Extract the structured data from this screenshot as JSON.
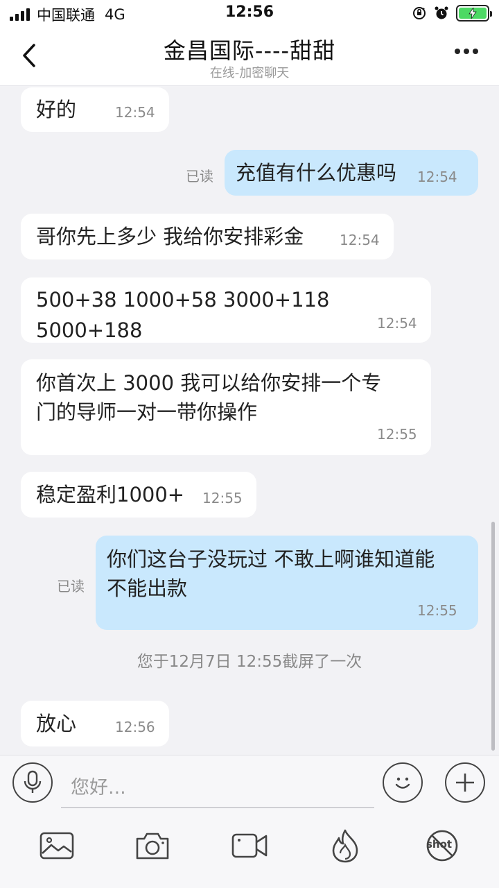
{
  "status_bar": {
    "carrier": "中国联通",
    "network": "4G",
    "time": "12:56"
  },
  "header": {
    "title": "金昌国际----甜甜",
    "subtitle": "在线-加密聊天"
  },
  "messages": [
    {
      "side": "left",
      "text": "好的",
      "time": "12:54"
    },
    {
      "side": "right",
      "text": "充值有什么优惠吗",
      "time": "12:54",
      "read": "已读"
    },
    {
      "side": "left",
      "text": "哥你先上多少 我给你安排彩金",
      "time": "12:54"
    },
    {
      "side": "left",
      "text": "500+38 1000+58 3000+118 5000+188",
      "time": "12:54"
    },
    {
      "side": "left",
      "line1": "你首次上 3000 我可以给你安排一个专",
      "line2": "门的导师一对一带你操作",
      "time": "12:55"
    },
    {
      "side": "left",
      "text": "稳定盈利1000+",
      "time": "12:55"
    },
    {
      "side": "right",
      "line1": "你们这台子没玩过 不敢上啊谁知道能",
      "line2": "不能出款",
      "time": "12:55",
      "read": "已读"
    },
    {
      "side": "left",
      "text": "放心",
      "time": "12:56"
    }
  ],
  "system_note": "您于12月7日 12:55截屏了一次",
  "input": {
    "placeholder": "您好..."
  },
  "toolbar": {
    "shot_label": "shot"
  },
  "colors": {
    "sent_bubble": "#c9e8fd",
    "received_bubble": "#ffffff",
    "background": "#f2f2f5",
    "battery": "#4cd964"
  }
}
